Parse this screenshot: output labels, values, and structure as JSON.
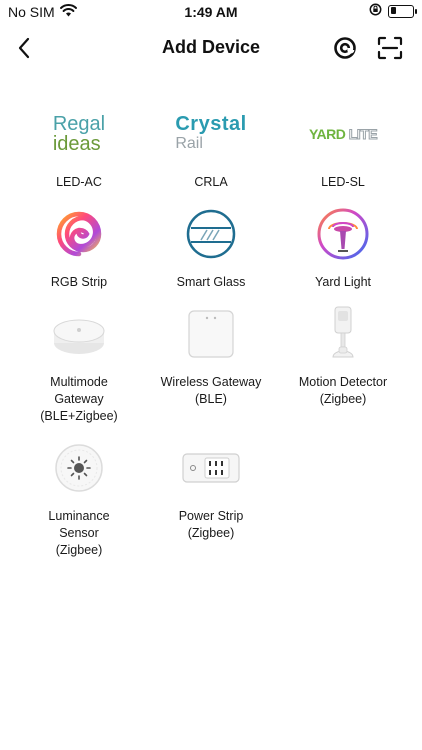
{
  "status_bar": {
    "carrier": "No SIM",
    "time": "1:49 AM",
    "battery_level": 0.25
  },
  "nav": {
    "title": "Add Device",
    "back_icon": "chevron-left-icon",
    "at_icon": "at-sign-icon",
    "scan_icon": "scan-icon"
  },
  "brands": {
    "regal_line1": "Regal",
    "regal_line2": "ideas",
    "crystal_line1": "Crystal",
    "crystal_line2": "Rail",
    "yard_a": "YARD",
    "yard_b": "LITE"
  },
  "devices": [
    {
      "label": "LED-AC",
      "icon": "regal-ideas-logo"
    },
    {
      "label": "CRLA",
      "icon": "crystal-rail-logo"
    },
    {
      "label": "LED-SL",
      "icon": "yard-lite-logo"
    },
    {
      "label": "RGB Strip",
      "icon": "rgb-strip-icon"
    },
    {
      "label": "Smart Glass",
      "icon": "smart-glass-icon"
    },
    {
      "label": "Yard Light",
      "icon": "yard-light-icon"
    },
    {
      "label": "Multimode\nGateway\n(BLE+Zigbee)",
      "icon": "multimode-gateway-icon"
    },
    {
      "label": "Wireless Gateway\n(BLE)",
      "icon": "wireless-gateway-icon"
    },
    {
      "label": "Motion Detector\n(Zigbee)",
      "icon": "motion-detector-icon"
    },
    {
      "label": "Luminance\nSensor\n(Zigbee)",
      "icon": "luminance-sensor-icon"
    },
    {
      "label": "Power Strip\n(Zigbee)",
      "icon": "power-strip-icon"
    }
  ]
}
